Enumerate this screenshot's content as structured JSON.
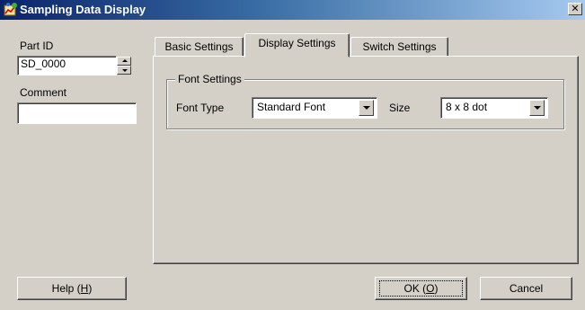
{
  "window": {
    "title": "Sampling Data Display",
    "close_glyph": "✕"
  },
  "left_panel": {
    "part_id_label": "Part ID",
    "part_id_value": "SD_0000",
    "comment_label": "Comment",
    "comment_value": ""
  },
  "tabs": [
    {
      "label": "Basic Settings",
      "active": false
    },
    {
      "label": "Display Settings",
      "active": true
    },
    {
      "label": "Switch Settings",
      "active": false
    }
  ],
  "font_settings": {
    "group_title": "Font Settings",
    "font_type_label": "Font Type",
    "font_type_value": "Standard Font",
    "size_label": "Size",
    "size_value": "8 x 8 dot"
  },
  "buttons": {
    "help": {
      "text": "Help (",
      "mnemonic": "H",
      "suffix": ")"
    },
    "ok": {
      "text": "OK (",
      "mnemonic": "O",
      "suffix": ")"
    },
    "cancel": {
      "text": "Cancel"
    }
  },
  "icons": {
    "title_icon": "sampling-data-icon",
    "spin_up": "arrow-up-icon",
    "spin_down": "arrow-down-icon",
    "combo_arrow": "chevron-down-icon"
  },
  "colors": {
    "titlebar_start": "#0a246a",
    "titlebar_end": "#a6caf0",
    "face": "#d4d0c8"
  }
}
